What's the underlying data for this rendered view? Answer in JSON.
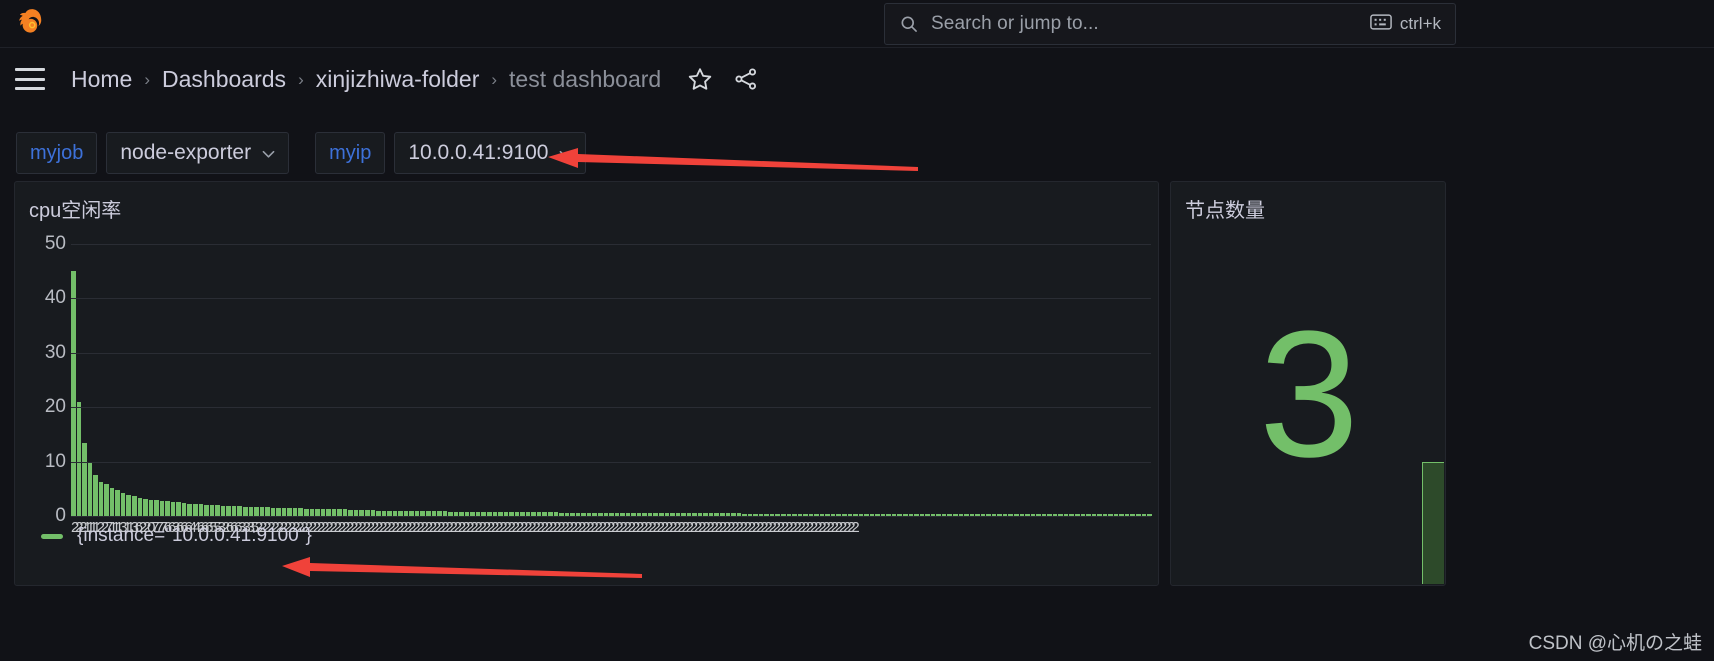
{
  "app": {
    "logo_icon": "grafana-logo-icon",
    "background": "#111217",
    "accent_green": "#73bf69",
    "accent_blue": "#3d71d9",
    "annotation_red": "#f0423a"
  },
  "search": {
    "placeholder": "Search or jump to...",
    "icon": "search-icon",
    "shortcut_label": "ctrl+k",
    "shortcut_icon": "keyboard-icon"
  },
  "breadcrumb": {
    "menu_icon": "hamburger-menu-icon",
    "separator": "›",
    "items": [
      {
        "label": "Home",
        "active": false
      },
      {
        "label": "Dashboards",
        "active": false
      },
      {
        "label": "xinjizhiwa-folder",
        "active": false
      },
      {
        "label": "test dashboard",
        "active": true
      }
    ],
    "actions": [
      {
        "name": "star-icon",
        "label": "Mark as favorite"
      },
      {
        "name": "share-icon",
        "label": "Share dashboard"
      }
    ]
  },
  "variables": [
    {
      "name": "myjob",
      "value": "node-exporter",
      "chevron": "⌄"
    },
    {
      "name": "myip",
      "value": "10.0.0.41:9100",
      "chevron": "⌄"
    }
  ],
  "panels": {
    "cpu": {
      "title": "cpu空闲率",
      "legend_label": "{instance=\"10.0.0.41:9100\"}",
      "xaxis_text": "22211112271113113622077766366644666553266633352222222222222222222222222222222222222222222222222222222222222222222222222222222222222222222222222222222222222222222222222222222222222222222222222"
    },
    "nodes": {
      "title": "节点数量",
      "value": "3"
    }
  },
  "chart_data": {
    "type": "bar",
    "title": "cpu空闲率",
    "xlabel": "",
    "ylabel": "",
    "ylim": [
      0,
      50
    ],
    "yticks": [
      0,
      10,
      20,
      30,
      40,
      50
    ],
    "grid": true,
    "legend_position": "bottom-left",
    "series": [
      {
        "name": "{instance=\"10.0.0.41:9100\"}",
        "color": "#73bf69",
        "values": [
          45.0,
          21.0,
          13.5,
          10.0,
          7.6,
          6.3,
          5.9,
          5.2,
          4.7,
          4.3,
          3.9,
          3.6,
          3.4,
          3.2,
          3.0,
          2.9,
          2.8,
          2.7,
          2.6,
          2.5,
          2.4,
          2.3,
          2.2,
          2.2,
          2.1,
          2.0,
          2.0,
          1.9,
          1.9,
          1.8,
          1.8,
          1.7,
          1.7,
          1.6,
          1.6,
          1.6,
          1.5,
          1.5,
          1.5,
          1.4,
          1.4,
          1.4,
          1.3,
          1.3,
          1.3,
          1.3,
          1.2,
          1.2,
          1.2,
          1.2,
          1.1,
          1.1,
          1.1,
          1.1,
          1.1,
          1.0,
          1.0,
          1.0,
          1.0,
          1.0,
          1.0,
          0.9,
          0.9,
          0.9,
          0.9,
          0.9,
          0.9,
          0.9,
          0.8,
          0.8,
          0.8,
          0.8,
          0.8,
          0.8,
          0.8,
          0.8,
          0.8,
          0.7,
          0.7,
          0.7,
          0.7,
          0.7,
          0.7,
          0.7,
          0.7,
          0.7,
          0.7,
          0.7,
          0.6,
          0.6,
          0.6,
          0.6,
          0.6,
          0.6,
          0.6,
          0.6,
          0.6,
          0.6,
          0.6,
          0.6,
          0.6,
          0.6,
          0.5,
          0.5,
          0.5,
          0.5,
          0.5,
          0.5,
          0.5,
          0.5,
          0.5,
          0.5,
          0.5,
          0.5,
          0.5,
          0.5,
          0.5,
          0.5,
          0.5,
          0.5,
          0.5,
          0.4,
          0.4,
          0.4,
          0.4,
          0.4,
          0.4,
          0.4,
          0.4,
          0.4,
          0.4,
          0.4,
          0.4,
          0.4,
          0.4,
          0.4,
          0.4,
          0.4,
          0.4,
          0.4,
          0.4,
          0.4,
          0.4,
          0.4,
          0.4,
          0.4,
          0.4,
          0.4,
          0.4,
          0.4,
          0.4,
          0.4,
          0.4,
          0.3,
          0.3,
          0.3,
          0.3,
          0.3,
          0.3,
          0.3,
          0.3,
          0.3,
          0.3,
          0.3,
          0.3,
          0.3,
          0.3,
          0.3,
          0.3,
          0.3,
          0.3,
          0.3,
          0.3,
          0.3,
          0.3,
          0.3,
          0.3,
          0.3,
          0.3,
          0.3,
          0.3,
          0.3,
          0.3,
          0.3,
          0.3,
          0.3,
          0.3,
          0.3,
          0.3,
          0.3,
          0.3,
          0.3,
          0.3,
          0.3,
          0.3
        ]
      }
    ]
  },
  "annotations": [
    {
      "name": "arrow-to-variable",
      "color": "#f0423a"
    },
    {
      "name": "arrow-to-legend",
      "color": "#f0423a"
    }
  ],
  "watermark": "CSDN @心机の之蛙"
}
